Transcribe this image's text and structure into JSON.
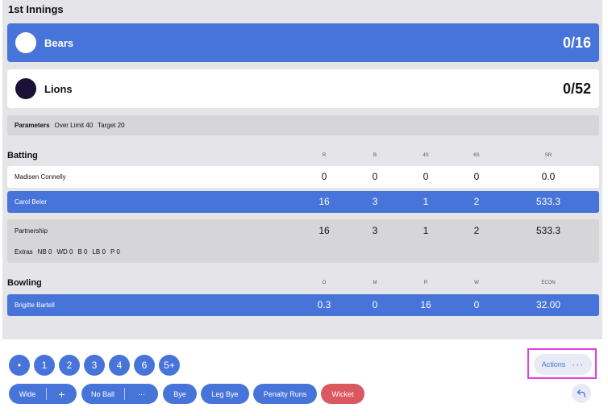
{
  "innings": {
    "title": "1st Innings"
  },
  "teams": [
    {
      "name": "Bears",
      "score": "0/16"
    },
    {
      "name": "Lions",
      "score": "0/52"
    }
  ],
  "parameters": {
    "label": "Parameters",
    "over_limit": "Over Limit 40",
    "target": "Target 20"
  },
  "batting": {
    "title": "Batting",
    "columns": [
      "R",
      "B",
      "4S",
      "6S",
      "SR"
    ],
    "rows": [
      {
        "name": "Madisen Connelly",
        "r": "0",
        "b": "0",
        "fours": "0",
        "sixes": "0",
        "sr": "0.0"
      },
      {
        "name": "Carol Beier",
        "r": "16",
        "b": "3",
        "fours": "1",
        "sixes": "2",
        "sr": "533.3"
      }
    ],
    "partnership": {
      "name": "Partnership",
      "r": "16",
      "b": "3",
      "fours": "1",
      "sixes": "2",
      "sr": "533.3"
    },
    "extras": {
      "label": "Extras",
      "nb": "NB 0",
      "wd": "WD 0",
      "b": "B 0",
      "lb": "LB 0",
      "p": "P 0"
    }
  },
  "bowling": {
    "title": "Bowling",
    "columns": [
      "O",
      "M",
      "R",
      "W",
      "ECON"
    ],
    "rows": [
      {
        "name": "Brigitte Bartell",
        "o": "0.3",
        "m": "0",
        "r": "16",
        "w": "0",
        "econ": "32.00"
      }
    ]
  },
  "runs": {
    "dot": "•",
    "one": "1",
    "two": "2",
    "three": "3",
    "four": "4",
    "six": "6",
    "five_plus": "5+"
  },
  "extras_buttons": {
    "wide": "Wide",
    "wide_plus": "+",
    "no_ball": "No Ball",
    "no_ball_more": "···",
    "bye": "Bye",
    "leg_bye": "Leg Bye",
    "penalty": "Penalty Runs",
    "wicket": "Wicket"
  },
  "actions": {
    "label": "Actions",
    "more": "···"
  },
  "colors": {
    "primary": "#4774d9",
    "wicket": "#dc5860",
    "panel": "#e5e5e9",
    "highlight": "#e040e0"
  }
}
